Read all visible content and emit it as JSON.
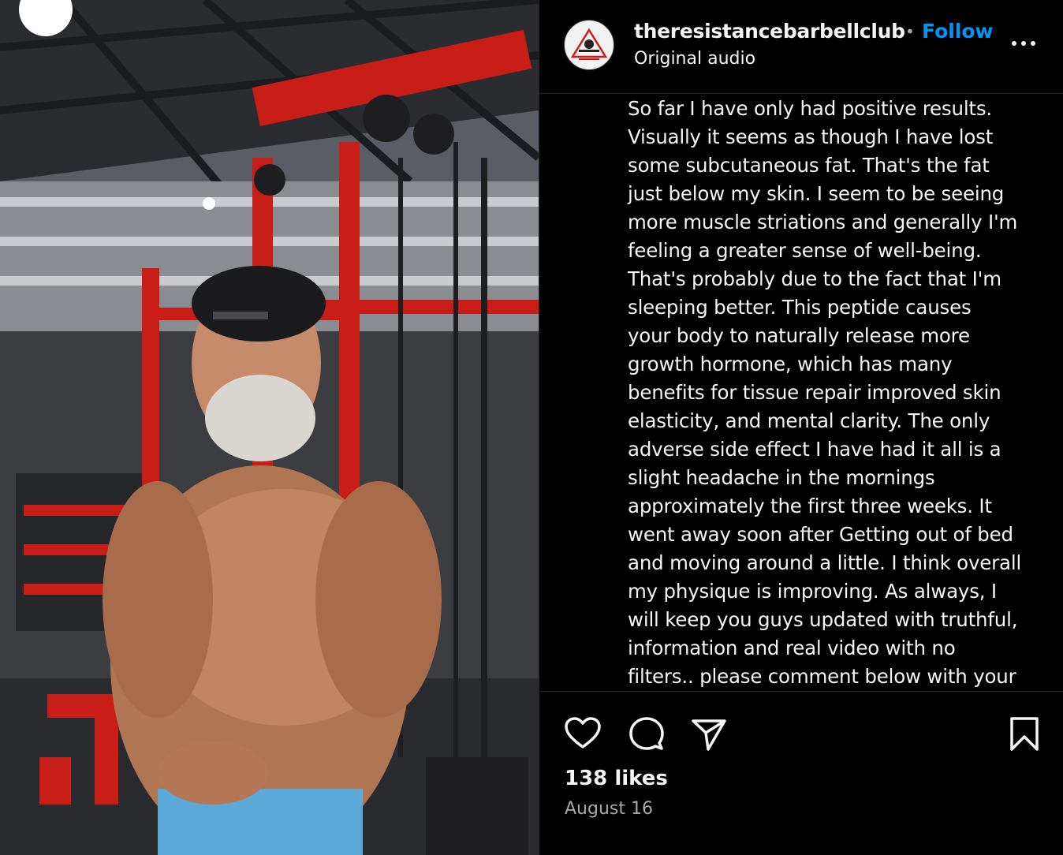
{
  "post": {
    "username": "theresistancebarbellclub",
    "separator": "•",
    "follow_label": "Follow",
    "audio_label": "Original audio",
    "caption_lines": [
      "So far I have only had positive results.",
      "Visually it seems as though I have lost",
      "some subcutaneous fat. That's the fat",
      "just below my skin. I seem to be seeing",
      "more muscle striations and generally I'm",
      "feeling a greater sense of well-being.",
      "That's probably due to the fact that I'm",
      "sleeping better. This peptide causes",
      "your body to naturally release more",
      "growth hormone, which has many",
      "benefits for tissue repair improved skin",
      "elasticity, and mental clarity. The only",
      "adverse side effect I have had it all is a",
      "slight headache in the mornings",
      "approximately the first three weeks. It",
      "went away soon after Getting out of bed",
      "and moving around a little. I think overall",
      "my physique is improving. As always, I",
      "will keep you guys updated with truthful,",
      "information and real video with no",
      "filters.. please comment below with your"
    ],
    "likes": "138 likes",
    "date": "August 16"
  },
  "icons": {
    "like": "heart-icon",
    "comment": "comment-icon",
    "share": "share-icon",
    "save": "bookmark-icon",
    "more": "more-icon"
  },
  "colors": {
    "background": "#000000",
    "follow": "#0095f6",
    "text": "#f5f5f5",
    "muted": "#a8a8a8",
    "gym_red": "#d9221b"
  }
}
